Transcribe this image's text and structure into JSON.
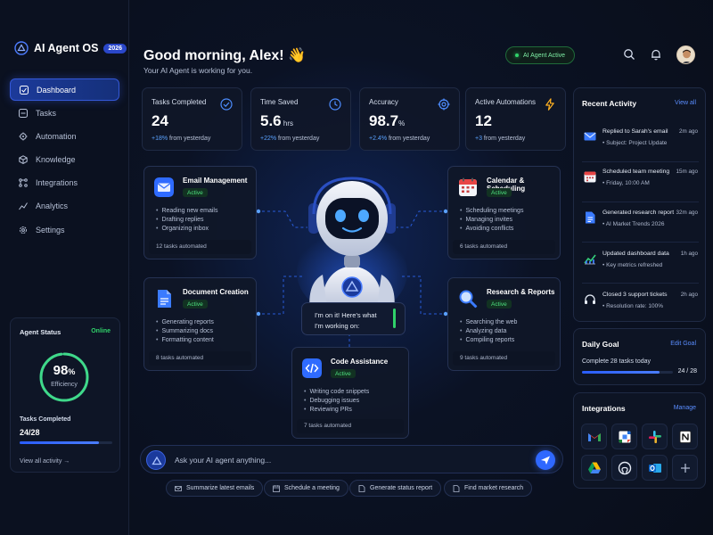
{
  "brand": {
    "name": "AI Agent OS",
    "badge": "2026"
  },
  "sidebar": {
    "items": [
      {
        "label": "Dashboard",
        "icon": "dashboard-icon",
        "active": true
      },
      {
        "label": "Tasks",
        "icon": "tasks-icon"
      },
      {
        "label": "Automation",
        "icon": "automation-icon"
      },
      {
        "label": "Knowledge",
        "icon": "knowledge-icon"
      },
      {
        "label": "Integrations",
        "icon": "integrations-icon"
      },
      {
        "label": "Analytics",
        "icon": "analytics-icon"
      },
      {
        "label": "Settings",
        "icon": "settings-icon"
      }
    ]
  },
  "agent_status": {
    "title": "Agent Status",
    "state": "Online",
    "efficiency_value": "98",
    "efficiency_unit": "%",
    "efficiency_fraction": 0.98,
    "efficiency_label": "Efficiency",
    "tasks_label": "Tasks Completed",
    "tasks_value": "24/28",
    "tasks_fraction": 0.857,
    "view_all": "View all activity →"
  },
  "header": {
    "greeting": "Good morning, Alex! 👋",
    "subtitle": "Your AI Agent is working for you.",
    "status_pill": "AI Agent Active"
  },
  "stats": [
    {
      "label": "Tasks Completed",
      "value": "24",
      "unit": "",
      "change": "+18%",
      "change_suffix": " from yesterday",
      "icon": "check-circle-icon"
    },
    {
      "label": "Time Saved",
      "value": "5.6",
      "unit": " hrs",
      "change": "+22%",
      "change_suffix": " from yesterday",
      "icon": "clock-icon"
    },
    {
      "label": "Accuracy",
      "value": "98.7",
      "unit": "%",
      "change": "+2.4%",
      "change_suffix": " from yesterday",
      "icon": "target-icon"
    },
    {
      "label": "Active Automations",
      "value": "12",
      "unit": "",
      "change": "+3",
      "change_suffix": " from yesterday",
      "icon": "lightning-icon"
    }
  ],
  "features": [
    {
      "title": "Email Management",
      "badge": "Active",
      "items": [
        "Reading new emails",
        "Drafting replies",
        "Organizing inbox"
      ],
      "footer": "12 tasks automated",
      "icon": "mail-icon"
    },
    {
      "title": "Calendar & Scheduling",
      "badge": "Active",
      "items": [
        "Scheduling meetings",
        "Managing invites",
        "Avoiding conflicts"
      ],
      "footer": "6 tasks automated",
      "icon": "calendar-icon"
    },
    {
      "title": "Document Creation",
      "badge": "Active",
      "items": [
        "Generating reports",
        "Summarizing docs",
        "Formatting content"
      ],
      "footer": "8 tasks automated",
      "icon": "document-icon"
    },
    {
      "title": "Research & Reports",
      "badge": "Active",
      "items": [
        "Searching the web",
        "Analyzing data",
        "Compiling reports"
      ],
      "footer": "9 tasks automated",
      "icon": "search-magnifier-icon"
    },
    {
      "title": "Code Assistance",
      "badge": "Active",
      "items": [
        "Writing code snippets",
        "Debugging issues",
        "Reviewing PRs"
      ],
      "footer": "7 tasks automated",
      "icon": "code-icon"
    }
  ],
  "bubble": {
    "line1": "I'm on it! Here's what",
    "line2": "I'm working on:"
  },
  "ask": {
    "placeholder": "Ask your AI agent anything..."
  },
  "quick_actions": [
    {
      "label": "Summarize latest emails",
      "icon": "mail-icon"
    },
    {
      "label": "Schedule a meeting",
      "icon": "calendar-icon"
    },
    {
      "label": "Generate status report",
      "icon": "document-icon"
    },
    {
      "label": "Find market research",
      "icon": "document-icon"
    }
  ],
  "recent_activity": {
    "title": "Recent Activity",
    "link": "View all",
    "items": [
      {
        "title": "Replied to Sarah's email",
        "sub": "• Subject: Project Update",
        "time": "2m ago",
        "icon": "mail-icon"
      },
      {
        "title": "Scheduled team meeting",
        "sub": "• Friday, 10:00 AM",
        "time": "15m ago",
        "icon": "calendar-icon"
      },
      {
        "title": "Generated research report",
        "sub": "• AI Market Trends 2026",
        "time": "32m ago",
        "icon": "document-icon"
      },
      {
        "title": "Updated dashboard data",
        "sub": "• Key metrics refreshed",
        "time": "1h ago",
        "icon": "chart-icon"
      },
      {
        "title": "Closed 3 support tickets",
        "sub": "• Resolution rate: 100%",
        "time": "2h ago",
        "icon": "headset-icon"
      }
    ]
  },
  "daily_goal": {
    "title": "Daily Goal",
    "link": "Edit Goal",
    "text": "Complete 28 tasks today",
    "value": "24 / 28",
    "fraction": 0.857
  },
  "integrations": {
    "title": "Integrations",
    "link": "Manage",
    "apps": [
      "gmail-icon",
      "google-calendar-icon",
      "slack-icon",
      "notion-icon",
      "google-drive-icon",
      "github-icon",
      "outlook-icon",
      "add-icon"
    ]
  },
  "colors": {
    "accent": "#2f68ff",
    "active_green": "#30d26a",
    "background": "#0a0f1c"
  }
}
